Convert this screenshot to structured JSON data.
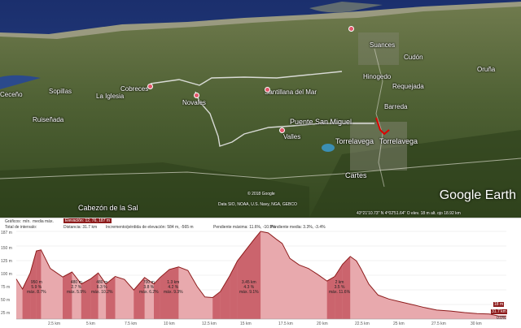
{
  "map": {
    "places": [
      {
        "id": "cobreces",
        "name": "Cobreces"
      },
      {
        "id": "soplillas",
        "name": "Sopillas"
      },
      {
        "id": "ceceno",
        "name": "Ceceño"
      },
      {
        "id": "la-iglesia",
        "name": "La Iglesia"
      },
      {
        "id": "novales",
        "name": "Novales"
      },
      {
        "id": "santillana",
        "name": "Santillana del Mar"
      },
      {
        "id": "ruisenada",
        "name": "Ruiseñada"
      },
      {
        "id": "puente-san-miguel",
        "name": "Puente San Miguel"
      },
      {
        "id": "valles",
        "name": "Valles"
      },
      {
        "id": "torrelavega-1",
        "name": "Torrelavega"
      },
      {
        "id": "torrelavega-2",
        "name": "Torrelavega"
      },
      {
        "id": "cartes",
        "name": "Cartes"
      },
      {
        "id": "cabezon",
        "name": "Cabezón de la Sal"
      },
      {
        "id": "barreda",
        "name": "Barreda"
      },
      {
        "id": "requejada",
        "name": "Requejada"
      },
      {
        "id": "cudon",
        "name": "Cudón"
      },
      {
        "id": "oruna",
        "name": "Oruña"
      },
      {
        "id": "suances",
        "name": "Suances"
      },
      {
        "id": "hinogedo",
        "name": "Hinogedo"
      }
    ],
    "copyright": "© 2018 Google",
    "data_source": "Data SIO, NOAA, U.S. Navy, NGA, GEBCO",
    "logo": "Google Earth",
    "status": "43°21'10.73\" N   4°02'51.64\" O   elev.  18 m    alt. ojo  18.92 km"
  },
  "profile": {
    "header": {
      "graphs_label": "Gráficos:",
      "tab_min": "mín.",
      "tab_avg": "media",
      "tab_max": "máx.",
      "elevation_selected": "Elevación: 12, 76, 187 m",
      "total_label": "Total de intervalo:",
      "distance": "Distancia: 31.7 km",
      "gain_loss": "Incremento/pérdida de elevación: 584 m, -565 m",
      "max_slope": "Pendiente máxima: 11.6%, -10.9%",
      "avg_slope": "Pendiente media: 3.3%, -3.4%"
    },
    "y_ticks": [
      "187 m",
      "150 m",
      "125 m",
      "100 m",
      "75 m",
      "50 m",
      "25 m"
    ],
    "x_ticks": [
      "2.5 km",
      "5 km",
      "7.5 km",
      "10 km",
      "12.5 km",
      "15 km",
      "17.5 km",
      "20 km",
      "22.5 km",
      "25 km",
      "27.5 km",
      "30 km"
    ],
    "segments": [
      {
        "dist": "950 m",
        "avg": "5.9 %",
        "max": "máx. 8.7%"
      },
      {
        "dist": "480 m",
        "avg": "2.7 %",
        "max": "máx. 5.9%"
      },
      {
        "dist": "480 m",
        "avg": "6.3 %",
        "max": "máx. 10.2%"
      },
      {
        "dist": "700 m",
        "avg": "3.8 %",
        "max": "máx. 6.2%"
      },
      {
        "dist": "1.3 km",
        "avg": "4.2 %",
        "max": "máx. 9.3%"
      },
      {
        "dist": "3.45 km",
        "avg": "4.3 %",
        "max": "máx. 9.1%"
      },
      {
        "dist": "2 km",
        "avg": "3.5 %",
        "max": "máx. 11.6%"
      }
    ],
    "end_elevation": "18 m",
    "end_distance": "31.7 km",
    "end_pct": "0.0%",
    "colors": {
      "fill": "#e8a9ad",
      "climb": "#c14e58",
      "line": "#8d1b1b"
    }
  },
  "chart_data": {
    "type": "area",
    "xlabel": "",
    "ylabel": "",
    "xlim": [
      0,
      31.7
    ],
    "ylim": [
      12,
      187
    ],
    "x": [
      0,
      0.4,
      0.9,
      1.3,
      1.6,
      2.2,
      3.0,
      3.6,
      4.2,
      4.8,
      5.3,
      5.8,
      6.4,
      7.0,
      7.6,
      8.3,
      8.9,
      9.3,
      9.9,
      10.5,
      11.1,
      11.7,
      12.2,
      12.7,
      13.2,
      13.8,
      14.3,
      14.9,
      15.4,
      15.8,
      16.3,
      16.8,
      17.2,
      17.7,
      18.3,
      18.9,
      19.5,
      20.1,
      20.6,
      21.1,
      21.6,
      22.0,
      22.3,
      22.8,
      23.4,
      24.1,
      24.9,
      25.6,
      26.4,
      27.2,
      28.1,
      29.0,
      29.8,
      30.6,
      31.2,
      31.7
    ],
    "y": [
      92,
      72,
      104,
      148,
      150,
      113,
      96,
      106,
      82,
      92,
      104,
      82,
      97,
      91,
      70,
      95,
      82,
      95,
      111,
      116,
      109,
      77,
      56,
      55,
      67,
      98,
      128,
      152,
      172,
      187,
      184,
      172,
      163,
      133,
      120,
      113,
      101,
      88,
      97,
      121,
      137,
      128,
      112,
      82,
      60,
      52,
      46,
      41,
      35,
      30,
      28,
      25,
      23,
      22,
      18,
      18
    ]
  }
}
